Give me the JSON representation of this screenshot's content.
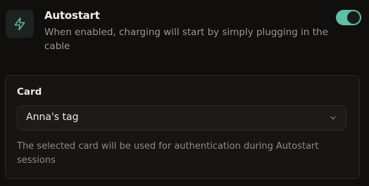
{
  "autostart": {
    "icon": "lightning-bolt-icon",
    "title": "Autostart",
    "description": "When enabled, charging will start by simply plugging in the cable",
    "enabled": true
  },
  "card": {
    "label": "Card",
    "selected": "Anna's tag",
    "helper_text": "The selected card will be used for authentication during Autostart sessions"
  },
  "colors": {
    "accent": "#5ec0a6",
    "background": "#100f0d"
  }
}
